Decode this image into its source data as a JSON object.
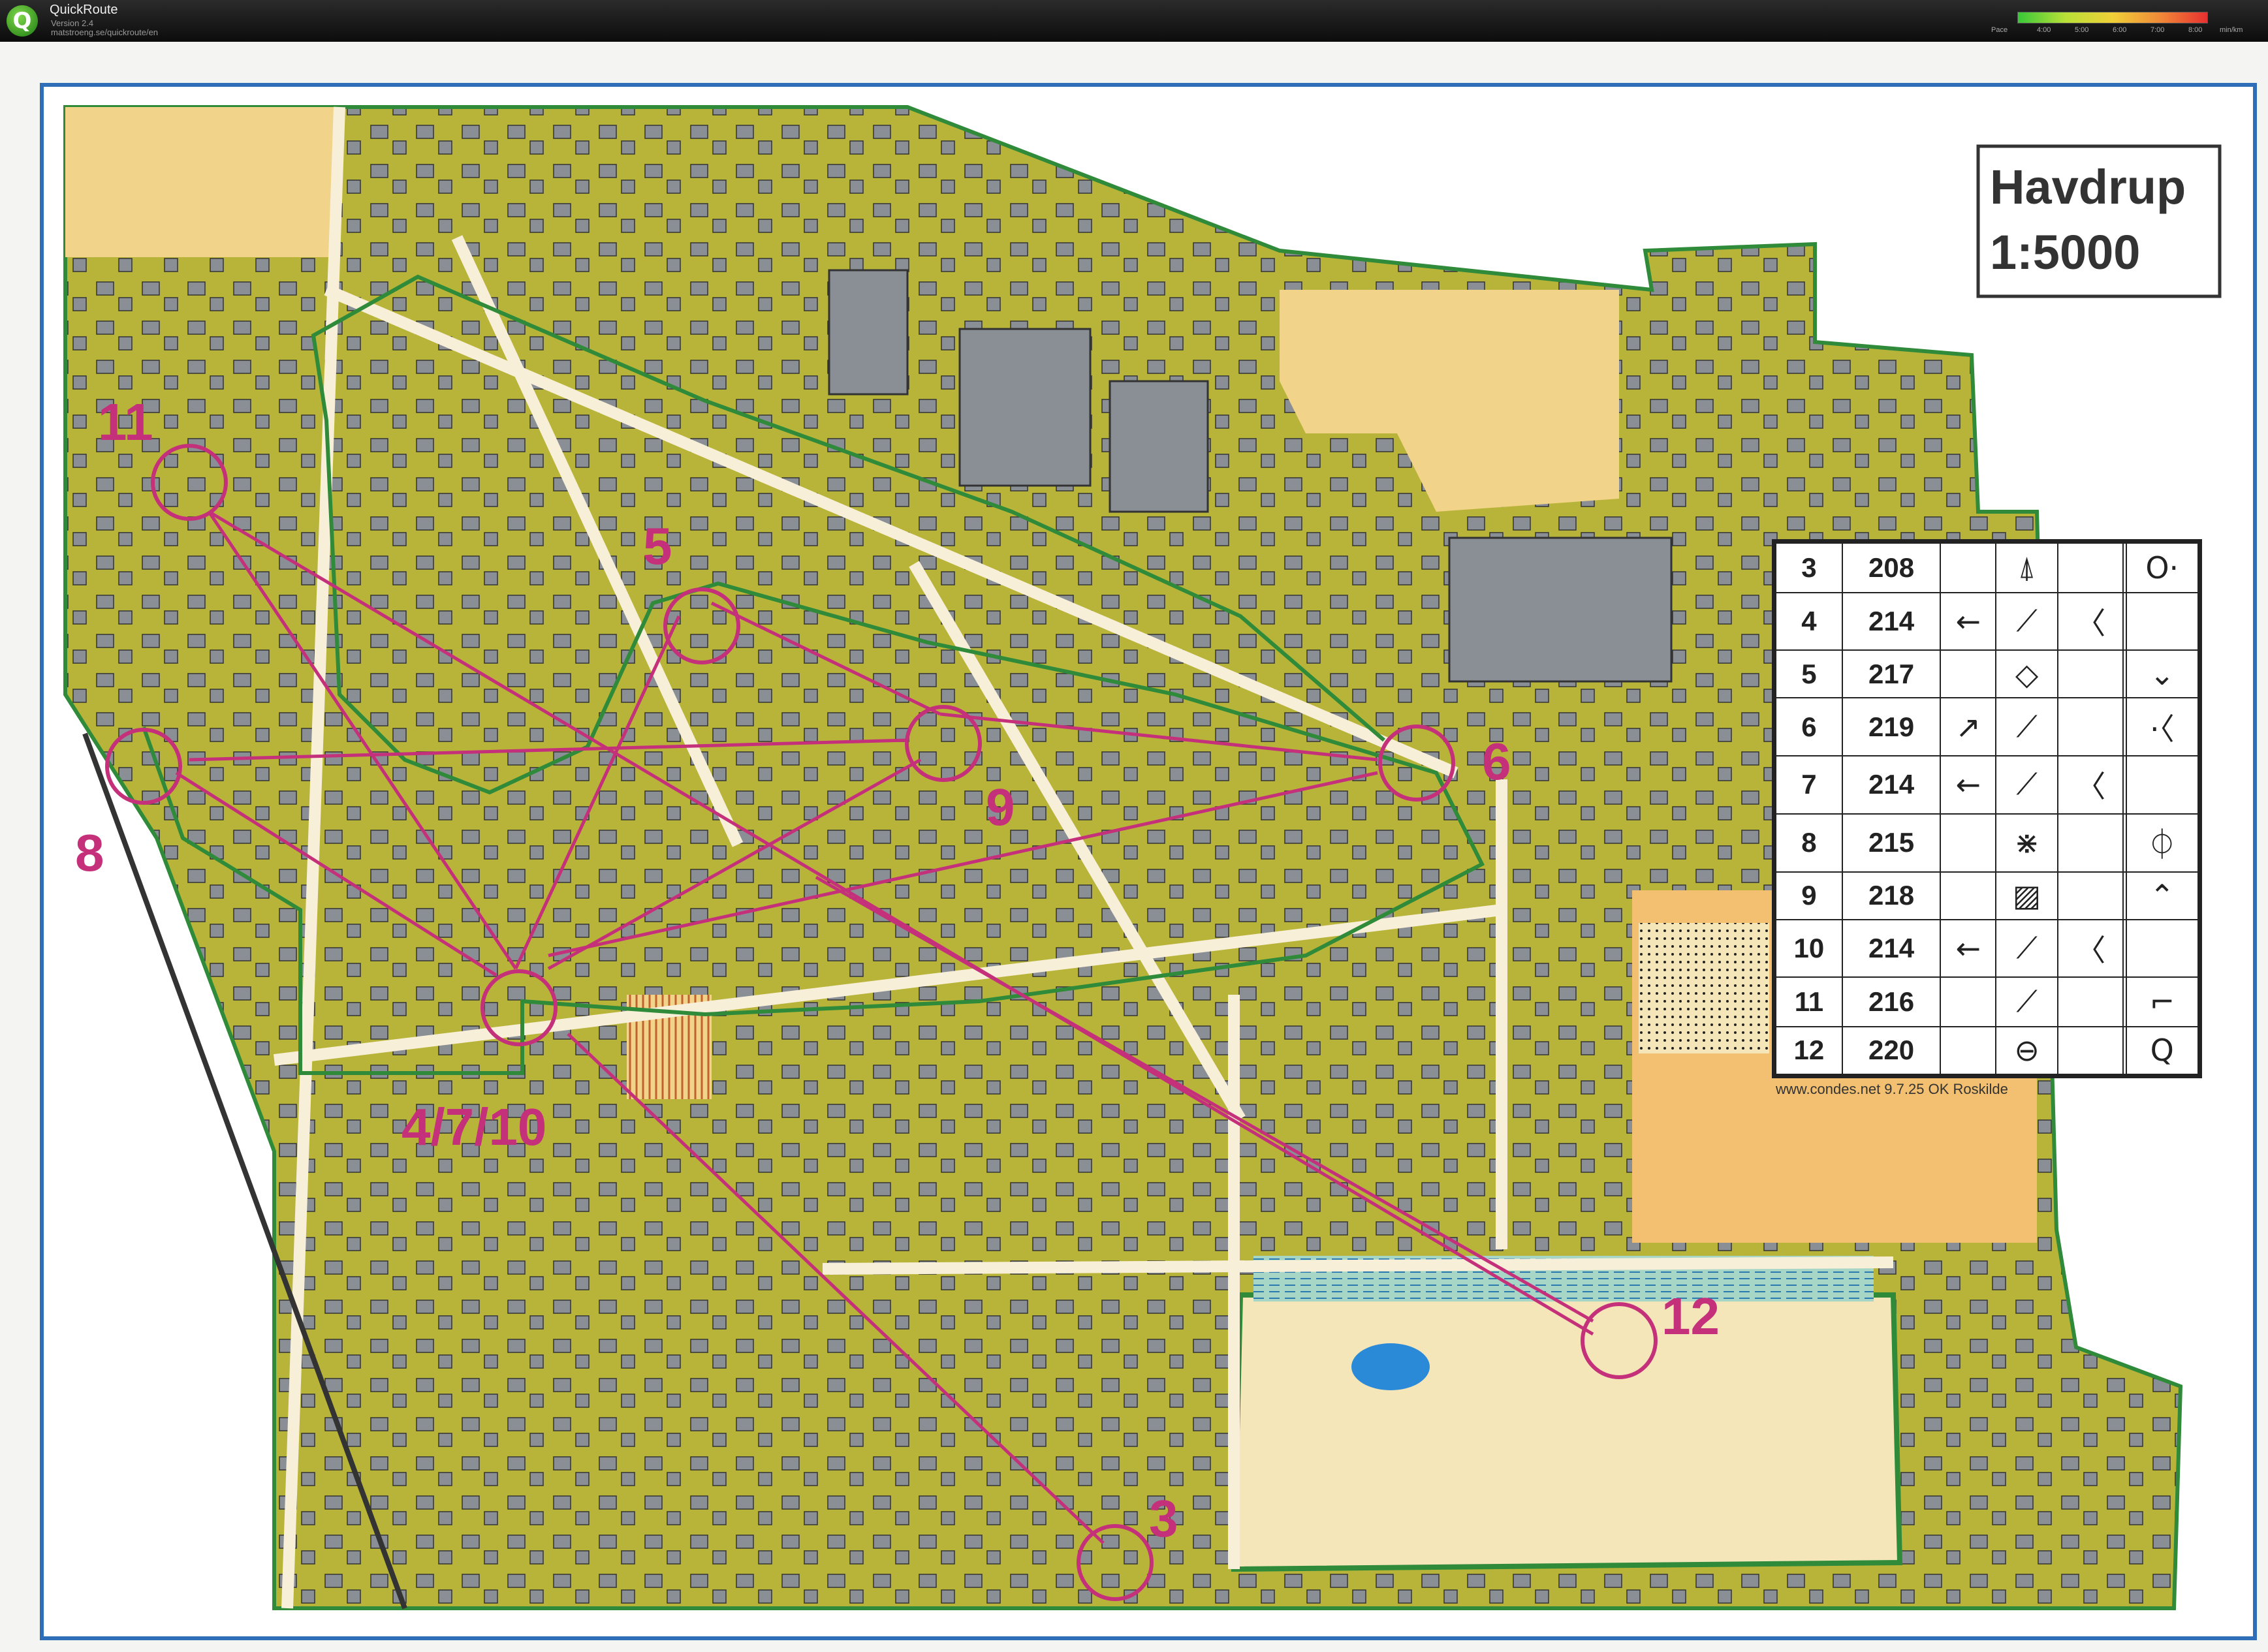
{
  "app": {
    "logo_letter": "Q",
    "name": "QuickRoute",
    "version": "Version 2.4",
    "url": "matstroeng.se/quickroute/en"
  },
  "pace_legend": {
    "label": "Pace",
    "ticks": [
      "4:00",
      "5:00",
      "6:00",
      "7:00",
      "8:00"
    ],
    "unit": "min/km"
  },
  "map": {
    "title_line1": "Havdrup",
    "title_line2": "1:5000",
    "credit": "www.condes.net 9.7.25 OK Roskilde",
    "colors": {
      "forest": "#b8b43a",
      "building": "#8a8f96",
      "open": "#f2d38a",
      "control": "#c5307a",
      "route": "#2f8a3a"
    },
    "control_labels": [
      "11",
      "5",
      "8",
      "9",
      "6",
      "4/7/10",
      "12",
      "3"
    ]
  },
  "control_descriptions": {
    "rows": [
      {
        "num": "3",
        "code": "208",
        "dir": "",
        "feature": "⍋",
        "col": "",
        "position": "O·"
      },
      {
        "num": "4",
        "code": "214",
        "dir": "←",
        "feature": "⟋",
        "col": "〈",
        "position": ""
      },
      {
        "num": "5",
        "code": "217",
        "dir": "",
        "feature": "◇",
        "col": "",
        "position": "⌄"
      },
      {
        "num": "6",
        "code": "219",
        "dir": "↗",
        "feature": "⟋",
        "col": "",
        "position": "·〈"
      },
      {
        "num": "7",
        "code": "214",
        "dir": "←",
        "feature": "⟋",
        "col": "〈",
        "position": ""
      },
      {
        "num": "8",
        "code": "215",
        "dir": "",
        "feature": "⋇",
        "col": "",
        "position": "⏀"
      },
      {
        "num": "9",
        "code": "218",
        "dir": "",
        "feature": "▨",
        "col": "",
        "position": "⌃"
      },
      {
        "num": "10",
        "code": "214",
        "dir": "←",
        "feature": "⟋",
        "col": "〈",
        "position": ""
      },
      {
        "num": "11",
        "code": "216",
        "dir": "",
        "feature": "⟋",
        "col": "",
        "position": "⌐"
      },
      {
        "num": "12",
        "code": "220",
        "dir": "",
        "feature": "⊖",
        "col": "",
        "position": "Q"
      }
    ]
  }
}
